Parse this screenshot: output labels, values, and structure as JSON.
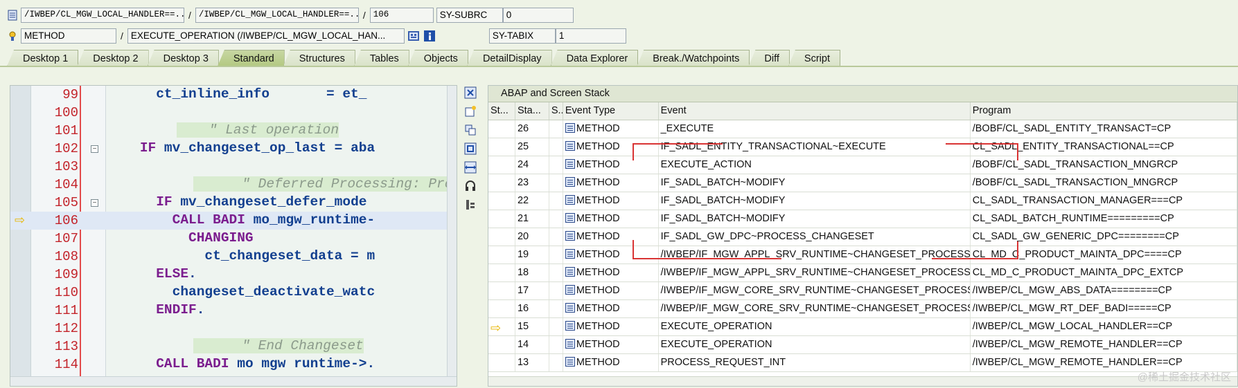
{
  "header": {
    "row1": {
      "program": "/IWBEP/CL_MGW_LOCAL_HANDLER==...",
      "include": "/IWBEP/CL_MGW_LOCAL_HANDLER==...",
      "line": "106",
      "var_name": "SY-SUBRC",
      "var_value": "0"
    },
    "row2": {
      "type": "METHOD",
      "name": "EXECUTE_OPERATION (/IWBEP/CL_MGW_LOCAL_HAN...",
      "var_name": "SY-TABIX",
      "var_value": "1"
    },
    "separator": "/"
  },
  "tabs": [
    {
      "label": "Desktop 1"
    },
    {
      "label": "Desktop 2"
    },
    {
      "label": "Desktop 3"
    },
    {
      "label": "Standard",
      "active": true
    },
    {
      "label": "Structures"
    },
    {
      "label": "Tables"
    },
    {
      "label": "Objects"
    },
    {
      "label": "DetailDisplay"
    },
    {
      "label": "Data Explorer"
    },
    {
      "label": "Break./Watchpoints"
    },
    {
      "label": "Diff"
    },
    {
      "label": "Script"
    }
  ],
  "code": {
    "lines": [
      {
        "n": "99",
        "text": "      ct_inline_info       = et_"
      },
      {
        "n": "100",
        "text": ""
      },
      {
        "n": "101",
        "text": "    \" Last operation"
      },
      {
        "n": "102",
        "text": "    IF mv_changeset_op_last = aba"
      },
      {
        "n": "103",
        "text": ""
      },
      {
        "n": "104",
        "text": "      \" Deferred Processing: Proc"
      },
      {
        "n": "105",
        "text": "      IF mv_changeset_defer_mode "
      },
      {
        "n": "106",
        "text": "        CALL BADI mo_mgw_runtime-"
      },
      {
        "n": "107",
        "text": "          CHANGING"
      },
      {
        "n": "108",
        "text": "            ct_changeset_data = m"
      },
      {
        "n": "109",
        "text": "      ELSE."
      },
      {
        "n": "110",
        "text": "        changeset_deactivate_watc"
      },
      {
        "n": "111",
        "text": "      ENDIF."
      },
      {
        "n": "112",
        "text": ""
      },
      {
        "n": "113",
        "text": "      \" End Changeset"
      },
      {
        "n": "114",
        "text": "      CALL BADI mo mgw runtime->."
      }
    ]
  },
  "stack": {
    "title": "ABAP and Screen Stack",
    "columns": [
      "St...",
      "Sta...",
      "S...",
      "Event Type",
      "Event",
      "Program"
    ],
    "rows": [
      {
        "level": "26",
        "type": "METHOD",
        "event": "_EXECUTE",
        "program": "/BOBF/CL_SADL_ENTITY_TRANSACT=CP"
      },
      {
        "level": "25",
        "type": "METHOD",
        "event": "IF_SADL_ENTITY_TRANSACTIONAL~EXECUTE",
        "program": "CL_SADL_ENTITY_TRANSACTIONAL==CP"
      },
      {
        "level": "24",
        "type": "METHOD",
        "event": "EXECUTE_ACTION",
        "program": "/BOBF/CL_SADL_TRANSACTION_MNGRCP"
      },
      {
        "level": "23",
        "type": "METHOD",
        "event": "IF_SADL_BATCH~MODIFY",
        "program": "/BOBF/CL_SADL_TRANSACTION_MNGRCP"
      },
      {
        "level": "22",
        "type": "METHOD",
        "event": "IF_SADL_BATCH~MODIFY",
        "program": "CL_SADL_TRANSACTION_MANAGER===CP"
      },
      {
        "level": "21",
        "type": "METHOD",
        "event": "IF_SADL_BATCH~MODIFY",
        "program": "CL_SADL_BATCH_RUNTIME=========CP"
      },
      {
        "level": "20",
        "type": "METHOD",
        "event": "IF_SADL_GW_DPC~PROCESS_CHANGESET",
        "program": "CL_SADL_GW_GENERIC_DPC========CP"
      },
      {
        "level": "19",
        "type": "METHOD",
        "event": "/IWBEP/IF_MGW_APPL_SRV_RUNTIME~CHANGESET_PROCESS",
        "program": "CL_MD_C_PRODUCT_MAINTA_DPC====CP"
      },
      {
        "level": "18",
        "type": "METHOD",
        "event": "/IWBEP/IF_MGW_APPL_SRV_RUNTIME~CHANGESET_PROCESS",
        "program": "CL_MD_C_PRODUCT_MAINTA_DPC_EXTCP"
      },
      {
        "level": "17",
        "type": "METHOD",
        "event": "/IWBEP/IF_MGW_CORE_SRV_RUNTIME~CHANGESET_PROCESS",
        "program": "/IWBEP/CL_MGW_ABS_DATA========CP"
      },
      {
        "level": "16",
        "type": "METHOD",
        "event": "/IWBEP/IF_MGW_CORE_SRV_RUNTIME~CHANGESET_PROCESS",
        "program": "/IWBEP/CL_MGW_RT_DEF_BADI=====CP"
      },
      {
        "level": "15",
        "type": "METHOD",
        "event": "EXECUTE_OPERATION",
        "program": "/IWBEP/CL_MGW_LOCAL_HANDLER==CP",
        "current": true
      },
      {
        "level": "14",
        "type": "METHOD",
        "event": "EXECUTE_OPERATION",
        "program": "/IWBEP/CL_MGW_REMOTE_HANDLER==CP"
      },
      {
        "level": "13",
        "type": "METHOD",
        "event": "PROCESS_REQUEST_INT",
        "program": "/IWBEP/CL_MGW_REMOTE_HANDLER==CP"
      }
    ]
  },
  "watermark": "@稀土掘金技术社区"
}
